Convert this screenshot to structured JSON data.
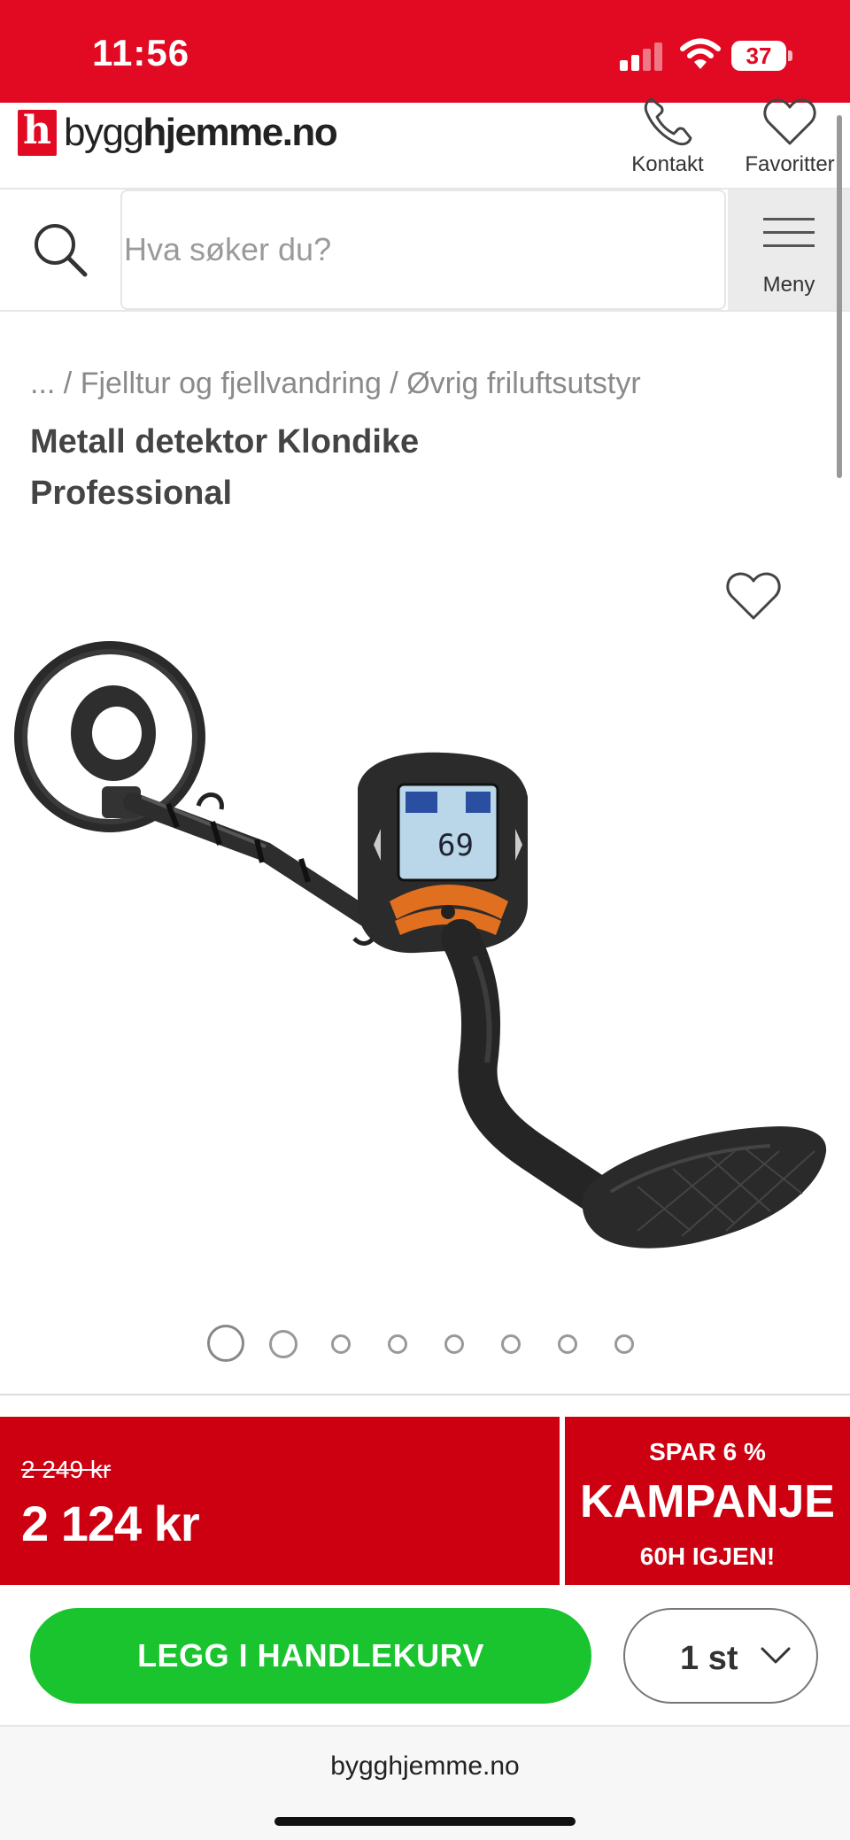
{
  "status_bar": {
    "time": "11:56",
    "battery": "37",
    "color": "#e10a22"
  },
  "header": {
    "logo_mark": "h",
    "logo_text_light": "bygg",
    "logo_text_bold": "hjemme.no",
    "kontakt_label": "Kontakt",
    "favoritter_label": "Favoritter",
    "icons": [
      "phone-icon",
      "heart-icon"
    ]
  },
  "search": {
    "placeholder": "Hva søker du?",
    "menu_label": "Meny"
  },
  "breadcrumb": {
    "ellipsis": "...",
    "sep1": " / ",
    "item1": "Fjelltur og fjellvandring",
    "sep2": " / ",
    "item2": "Øvrig friluftsutstyr"
  },
  "product": {
    "title_line1": "Metall detektor Klondike",
    "title_line2": "Professional",
    "display_reading": "69",
    "image_count": 8,
    "active_image": 1
  },
  "price": {
    "old": "2 249 kr",
    "current": "2 124 kr",
    "campaign_discount": "SPAR 6 %",
    "campaign_label": "KAMPANJE",
    "campaign_countdown": "60H IGJEN!",
    "accent_color": "#cc0011"
  },
  "cart": {
    "add_button": "LEGG I HANDLEKURV",
    "quantity": "1 st",
    "button_color": "#19c42f"
  },
  "browser": {
    "url": "bygghjemme.no"
  }
}
